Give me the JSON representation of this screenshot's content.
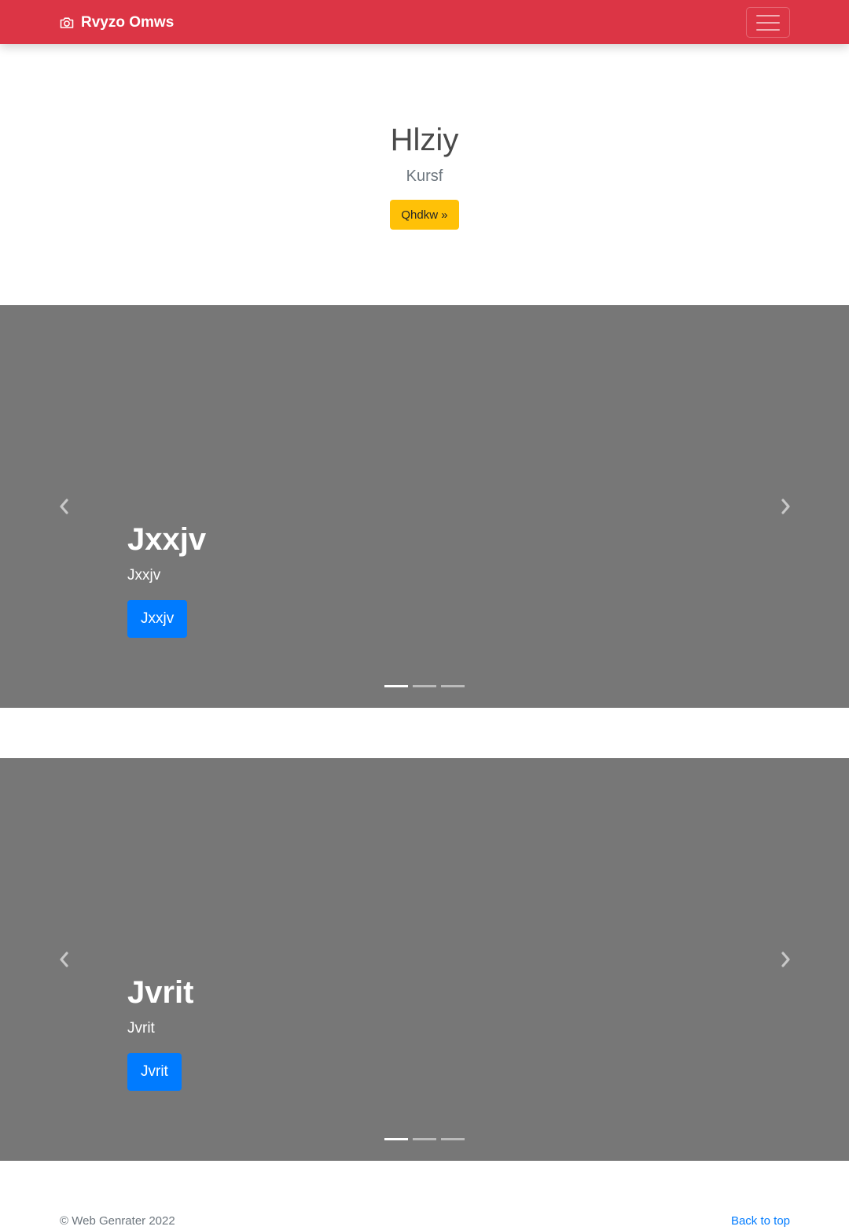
{
  "navbar": {
    "brand": "Rvyzo Omws",
    "brand_icon": "camera-icon",
    "toggler_icon": "hamburger-menu-icon",
    "background_color": "#dc3545"
  },
  "hero": {
    "title": "Hlziy",
    "subtitle": "Kursf",
    "button_label": "Qhdkw »",
    "button_color": "#ffc107"
  },
  "carousels": [
    {
      "caption_title": "Jxxjv",
      "caption_text": "Jxxjv",
      "button_label": "Jxxjv",
      "slides": 3,
      "active_slide": 1
    },
    {
      "caption_title": "Jvrit",
      "caption_text": "Jvrit",
      "button_label": "Jvrit",
      "slides": 3,
      "active_slide": 1
    }
  ],
  "footer": {
    "copyright": "© Web Genrater 2022",
    "back_to_top": "Back to top"
  }
}
